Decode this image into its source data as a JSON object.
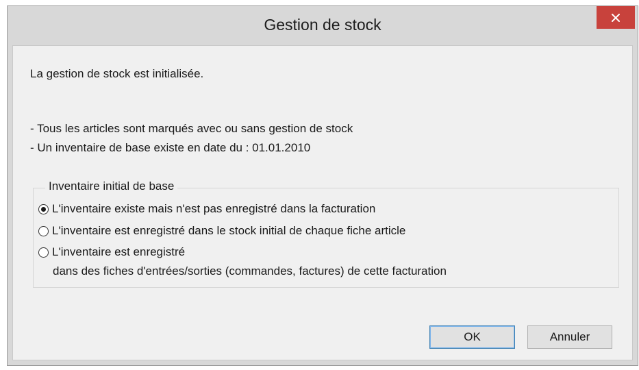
{
  "window": {
    "title": "Gestion de stock",
    "close_symbol": "×"
  },
  "message": {
    "intro": "La gestion de stock est initialisée.",
    "bullet1": "- Tous les articles sont marqués avec ou sans gestion de stock",
    "bullet2": "- Un inventaire de base existe en date du : 01.01.2010"
  },
  "group": {
    "legend": "Inventaire initial de base",
    "options": [
      {
        "label": "L'inventaire existe mais n'est pas enregistré dans la facturation",
        "selected": true
      },
      {
        "label": "L'inventaire est enregistré dans le stock initial de chaque fiche article",
        "selected": false
      },
      {
        "label": "L'inventaire est enregistré",
        "label_line2": "dans des fiches d'entrées/sorties (commandes, factures) de cette facturation",
        "selected": false
      }
    ]
  },
  "buttons": {
    "ok": "OK",
    "cancel": "Annuler"
  },
  "colors": {
    "close_button": "#c8423c",
    "dialog_frame": "#d8d8d8",
    "client_area": "#f0f0f0",
    "default_button_border": "#3c7fb1"
  }
}
